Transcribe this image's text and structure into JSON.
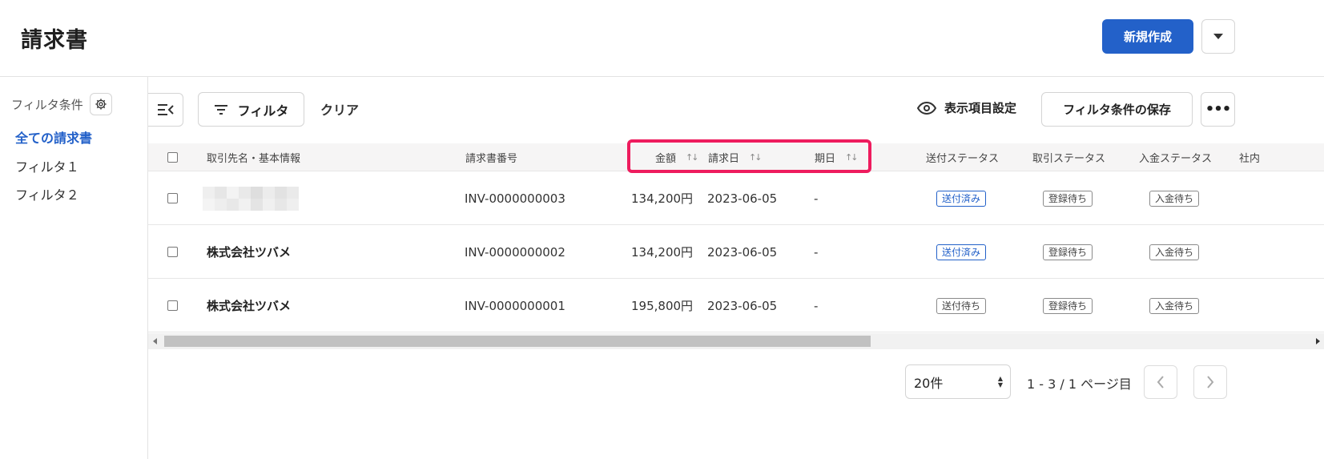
{
  "header": {
    "title": "請求書",
    "new_button": "新規作成"
  },
  "sidebar": {
    "heading": "フィルタ条件",
    "items": [
      {
        "label": "全ての請求書"
      },
      {
        "label": "フィルタ１"
      },
      {
        "label": "フィルタ２"
      }
    ]
  },
  "toolbar": {
    "filter": "フィルタ",
    "clear": "クリア",
    "display_settings": "表示項目設定",
    "save_filter": "フィルタ条件の保存"
  },
  "table": {
    "columns": {
      "name": "取引先名・基本情報",
      "invoice_no": "請求書番号",
      "amount": "金額",
      "date": "請求日",
      "due": "期日",
      "send_status": "送付ステータス",
      "trade_status": "取引ステータス",
      "payment_status": "入金ステータス",
      "overflow": "社内"
    },
    "rows": [
      {
        "name": "",
        "invoice_no": "INV-0000000003",
        "amount": "134,200円",
        "date": "2023-06-05",
        "due": "-",
        "send_status": "送付済み",
        "trade_status": "登録待ち",
        "payment_status": "入金待ち"
      },
      {
        "name": "株式会社ツバメ",
        "invoice_no": "INV-0000000002",
        "amount": "134,200円",
        "date": "2023-06-05",
        "due": "-",
        "send_status": "送付済み",
        "trade_status": "登録待ち",
        "payment_status": "入金待ち"
      },
      {
        "name": "株式会社ツバメ",
        "invoice_no": "INV-0000000001",
        "amount": "195,800円",
        "date": "2023-06-05",
        "due": "-",
        "send_status": "送付待ち",
        "trade_status": "登録待ち",
        "payment_status": "入金待ち"
      }
    ]
  },
  "pagination": {
    "page_size": "20件",
    "info": "1 - 3 / 1 ページ目"
  },
  "colors": {
    "accent": "#2361c9",
    "highlight": "#ee1c5e"
  }
}
